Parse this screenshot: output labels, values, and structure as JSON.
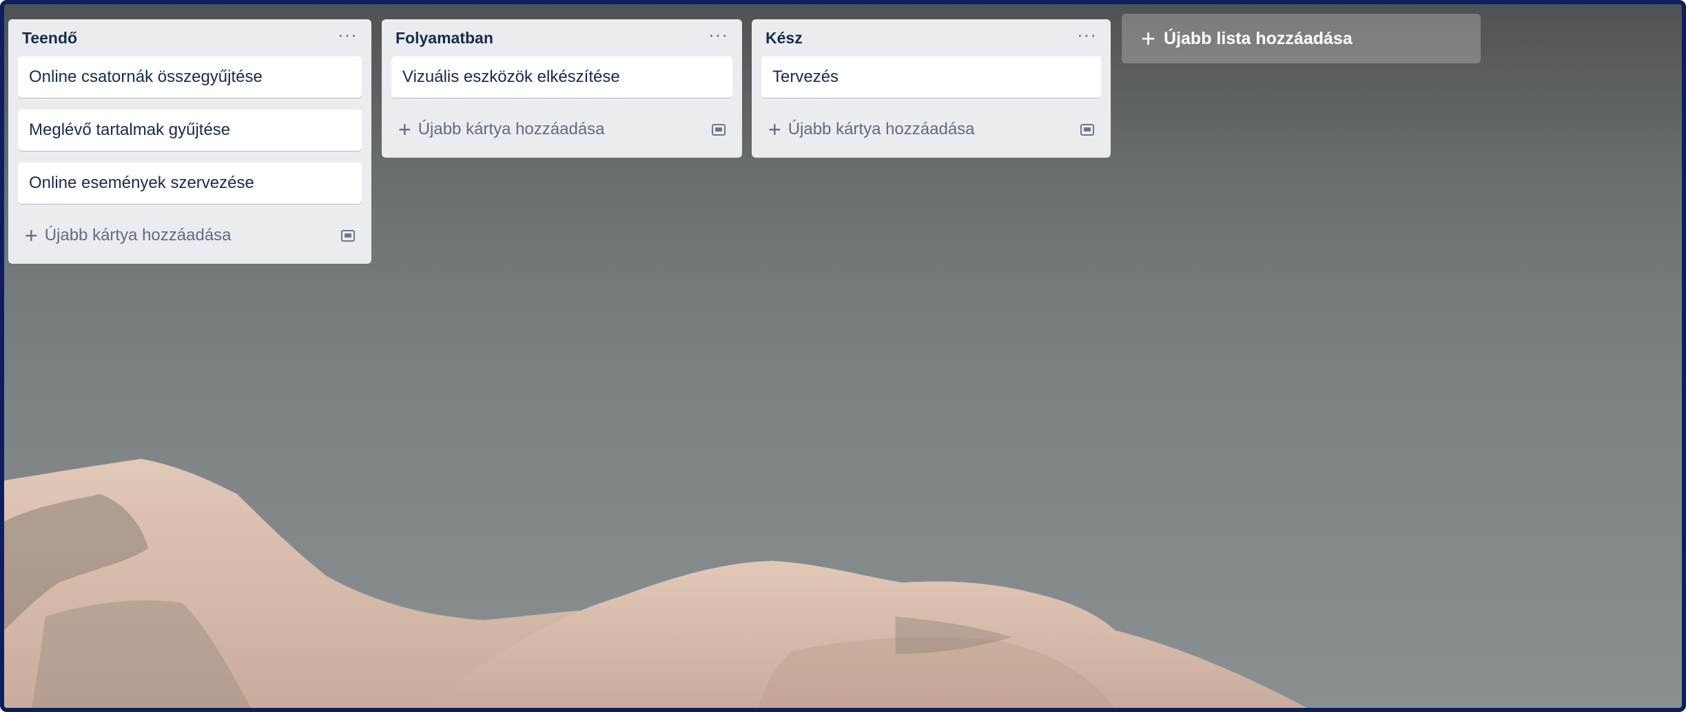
{
  "board": {
    "lists": [
      {
        "title": "Teendő",
        "menu": "···",
        "cards": [
          "Online csatornák összegyűjtése",
          "Meglévő tartalmak gyűjtése",
          "Online események szervezése"
        ],
        "add_card_label": "Újabb kártya hozzáadása"
      },
      {
        "title": "Folyamatban",
        "menu": "···",
        "cards": [
          "Vizuális eszközök elkészítése"
        ],
        "add_card_label": "Újabb kártya hozzáadása"
      },
      {
        "title": "Kész",
        "menu": "···",
        "cards": [
          "Tervezés"
        ],
        "add_card_label": "Újabb kártya hozzáadása"
      }
    ],
    "add_list_label": "Újabb lista hozzáadása",
    "plus_glyph": "+",
    "icons": {
      "list_menu": "ellipsis-icon",
      "add_card": "plus-icon",
      "card_template": "card-template-icon",
      "add_list": "plus-icon"
    },
    "colors": {
      "list_bg": "#ebecf0",
      "card_bg": "#ffffff",
      "text": "#172b4d",
      "muted": "#5e6c84",
      "frame_border": "#0c1f5c"
    }
  }
}
